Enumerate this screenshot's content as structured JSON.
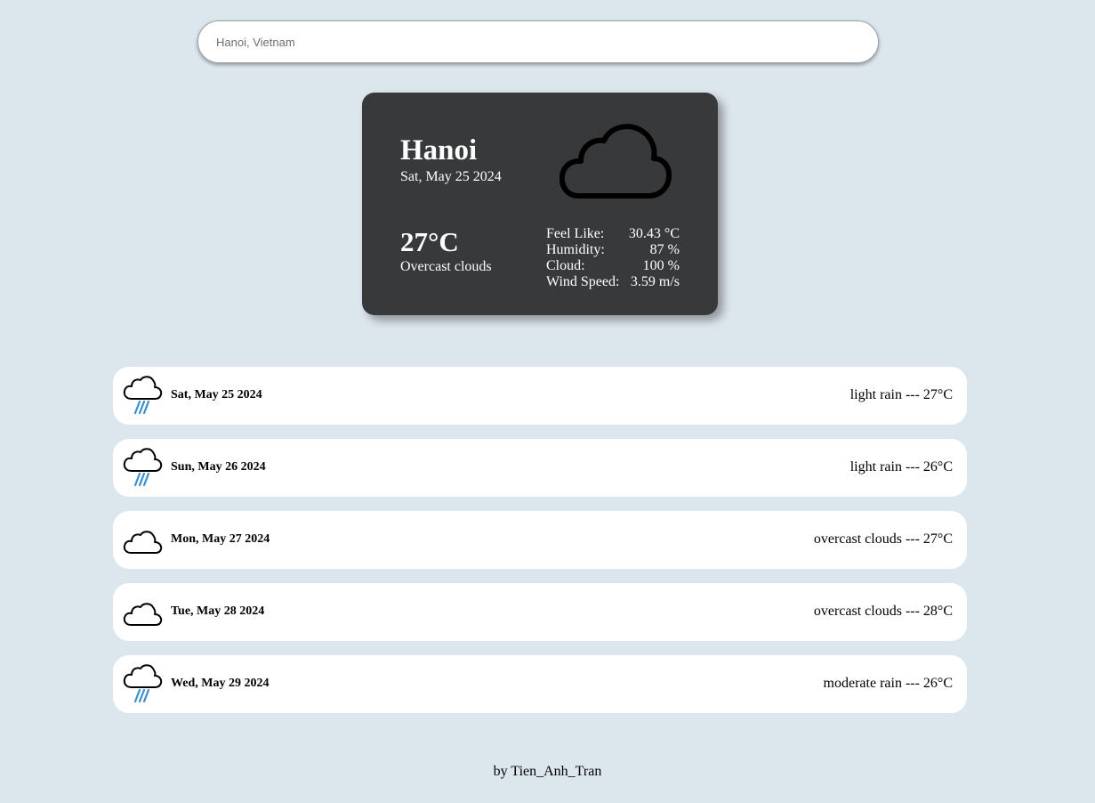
{
  "search": {
    "value": "",
    "placeholder": "Hanoi, Vietnam"
  },
  "current": {
    "city": "Hanoi",
    "date": "Sat, May 25 2024",
    "temperature": "27°C",
    "description": "Overcast clouds",
    "icon": "cloud-icon",
    "stats": [
      {
        "label": "Feel Like:",
        "value": "30.43 °C"
      },
      {
        "label": "Humidity:",
        "value": "87 %"
      },
      {
        "label": "Cloud:",
        "value": "100 %"
      },
      {
        "label": "Wind Speed:",
        "value": "3.59 m/s"
      }
    ]
  },
  "forecast": [
    {
      "date": "Sat, May 25 2024",
      "summary": "light rain --- 27°C",
      "icon": "rain-cloud-icon"
    },
    {
      "date": "Sun, May 26 2024",
      "summary": "light rain --- 26°C",
      "icon": "rain-cloud-icon"
    },
    {
      "date": "Mon, May 27 2024",
      "summary": "overcast clouds --- 27°C",
      "icon": "cloud-icon"
    },
    {
      "date": "Tue, May 28 2024",
      "summary": "overcast clouds --- 28°C",
      "icon": "cloud-icon"
    },
    {
      "date": "Wed, May 29 2024",
      "summary": "moderate rain --- 26°C",
      "icon": "rain-cloud-icon"
    }
  ],
  "footer": {
    "credit": "by Tien_Anh_Tran"
  },
  "colors": {
    "background": "#dce6ed",
    "card": "#38393b",
    "rain": "#3a8fd0"
  }
}
